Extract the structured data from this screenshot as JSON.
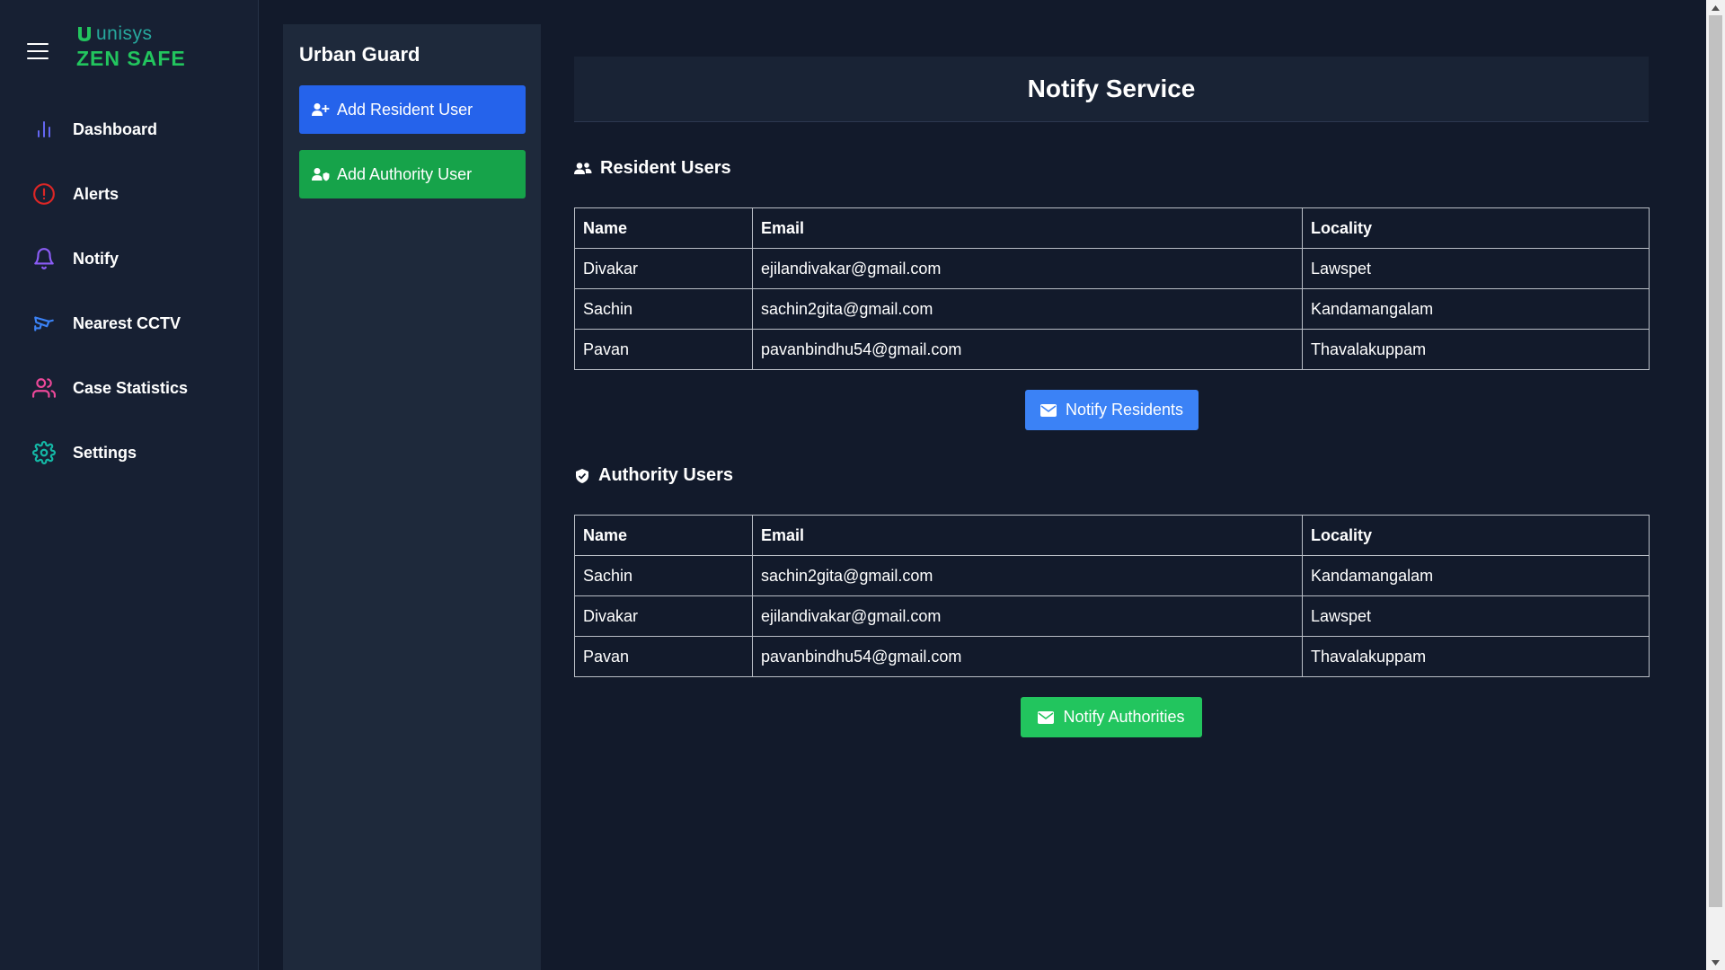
{
  "brand": {
    "company": "unisys",
    "product": "ZEN SAFE"
  },
  "sidebar": {
    "items": [
      {
        "label": "Dashboard",
        "icon": "bar-chart-icon",
        "color": "#6366f1"
      },
      {
        "label": "Alerts",
        "icon": "alert-circle-icon",
        "color": "#dc2626"
      },
      {
        "label": "Notify",
        "icon": "bell-icon",
        "color": "#8b5cf6"
      },
      {
        "label": "Nearest CCTV",
        "icon": "cctv-camera-icon",
        "color": "#3b82f6"
      },
      {
        "label": "Case Statistics",
        "icon": "users-icon",
        "color": "#ec4899"
      },
      {
        "label": "Settings",
        "icon": "gear-icon",
        "color": "#14b8a6"
      }
    ]
  },
  "panel": {
    "title": "Urban Guard",
    "add_resident_label": "Add Resident User",
    "add_authority_label": "Add Authority User"
  },
  "main": {
    "title": "Notify Service",
    "residents": {
      "title": "Resident Users",
      "columns": [
        "Name",
        "Email",
        "Locality"
      ],
      "rows": [
        [
          "Divakar",
          "ejilandivakar@gmail.com",
          "Lawspet"
        ],
        [
          "Sachin",
          "sachin2gita@gmail.com",
          "Kandamangalam"
        ],
        [
          "Pavan",
          "pavanbindhu54@gmail.com",
          "Thavalakuppam"
        ]
      ],
      "button_label": "Notify Residents"
    },
    "authorities": {
      "title": "Authority Users",
      "columns": [
        "Name",
        "Email",
        "Locality"
      ],
      "rows": [
        [
          "Sachin",
          "sachin2gita@gmail.com",
          "Kandamangalam"
        ],
        [
          "Divakar",
          "ejilandivakar@gmail.com",
          "Lawspet"
        ],
        [
          "Pavan",
          "pavanbindhu54@gmail.com",
          "Thavalakuppam"
        ]
      ],
      "button_label": "Notify Authorities"
    }
  },
  "colors": {
    "background": "#121a2b",
    "sidebar": "#172033",
    "panel": "#1e293b",
    "primary_blue": "#2563eb",
    "notify_blue": "#3b82f6",
    "success_green": "#16a34a",
    "notify_green": "#22c55e",
    "brand_teal": "#27a99e"
  }
}
